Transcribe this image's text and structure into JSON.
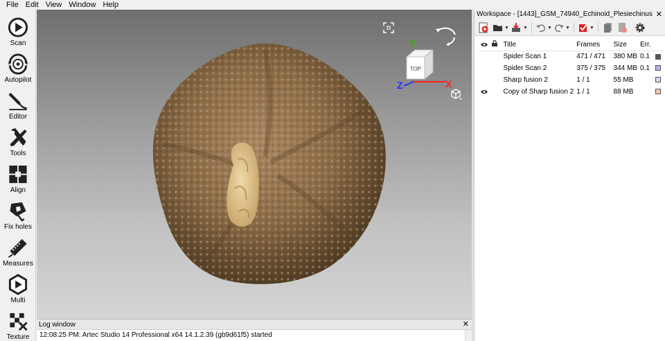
{
  "menu": [
    "File",
    "Edit",
    "View",
    "Window",
    "Help"
  ],
  "tools": [
    {
      "label": "Scan",
      "icon": "play-icon"
    },
    {
      "label": "Autopilot",
      "icon": "autopilot-icon"
    },
    {
      "label": "Editor",
      "icon": "eraser-icon"
    },
    {
      "label": "Tools",
      "icon": "tools-icon"
    },
    {
      "label": "Align",
      "icon": "align-icon"
    },
    {
      "label": "Fix holes",
      "icon": "fix-holes-icon"
    },
    {
      "label": "Measures",
      "icon": "measures-icon"
    },
    {
      "label": "Multi",
      "icon": "multi-icon"
    },
    {
      "label": "Texture",
      "icon": "texture-icon"
    }
  ],
  "viewport": {
    "gizmo": {
      "face": "TOP",
      "x_axis": "X",
      "y_axis": "Y",
      "z_axis": "Z"
    },
    "colors": {
      "x": "#ff2020",
      "y": "#38b000",
      "z": "#2030ff"
    }
  },
  "log": {
    "title": "Log window",
    "line": "12:08:25 PM: Artec Studio 14 Professional x64 14.1.2.39 (gb9d61f5) started"
  },
  "workspace": {
    "title": "Workspace - [1443]_GSM_74940_Echinoid_Plesiechinus",
    "columns": {
      "title": "Title",
      "frames": "Frames",
      "size": "Size",
      "err": "Err."
    },
    "rows": [
      {
        "visible": false,
        "title": "Spider Scan 1",
        "frames": "471 / 471",
        "size": "380 MB",
        "err": "0.1",
        "color": "#555555"
      },
      {
        "visible": false,
        "title": "Spider Scan 2",
        "frames": "375 / 375",
        "size": "344 MB",
        "err": "0.1",
        "color": "#b8b4e8"
      },
      {
        "visible": false,
        "title": "Sharp fusion 2",
        "frames": "1 / 1",
        "size": "55 MB",
        "err": "",
        "color": "#d8d4f0"
      },
      {
        "visible": true,
        "title": "Copy of Sharp fusion 2",
        "frames": "1 / 1",
        "size": "88 MB",
        "err": "",
        "color": "#f0c8b8"
      }
    ]
  }
}
